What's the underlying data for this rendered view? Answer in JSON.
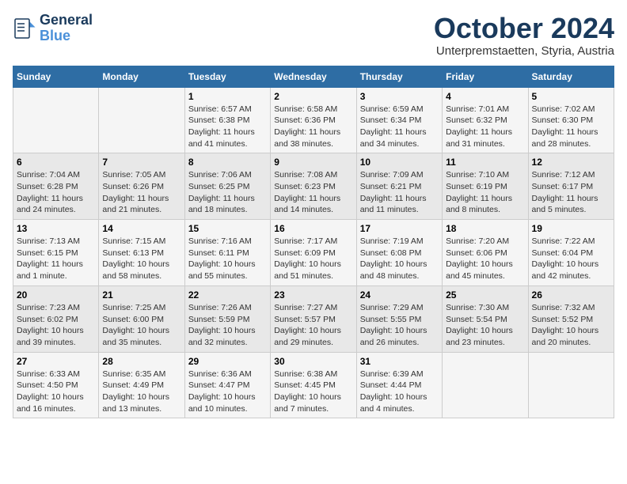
{
  "header": {
    "logo_line1": "General",
    "logo_line2": "Blue",
    "title": "October 2024",
    "subtitle": "Unterpremstaetten, Styria, Austria"
  },
  "columns": [
    "Sunday",
    "Monday",
    "Tuesday",
    "Wednesday",
    "Thursday",
    "Friday",
    "Saturday"
  ],
  "weeks": [
    [
      {
        "num": "",
        "info": ""
      },
      {
        "num": "",
        "info": ""
      },
      {
        "num": "1",
        "info": "Sunrise: 6:57 AM\nSunset: 6:38 PM\nDaylight: 11 hours and 41 minutes."
      },
      {
        "num": "2",
        "info": "Sunrise: 6:58 AM\nSunset: 6:36 PM\nDaylight: 11 hours and 38 minutes."
      },
      {
        "num": "3",
        "info": "Sunrise: 6:59 AM\nSunset: 6:34 PM\nDaylight: 11 hours and 34 minutes."
      },
      {
        "num": "4",
        "info": "Sunrise: 7:01 AM\nSunset: 6:32 PM\nDaylight: 11 hours and 31 minutes."
      },
      {
        "num": "5",
        "info": "Sunrise: 7:02 AM\nSunset: 6:30 PM\nDaylight: 11 hours and 28 minutes."
      }
    ],
    [
      {
        "num": "6",
        "info": "Sunrise: 7:04 AM\nSunset: 6:28 PM\nDaylight: 11 hours and 24 minutes."
      },
      {
        "num": "7",
        "info": "Sunrise: 7:05 AM\nSunset: 6:26 PM\nDaylight: 11 hours and 21 minutes."
      },
      {
        "num": "8",
        "info": "Sunrise: 7:06 AM\nSunset: 6:25 PM\nDaylight: 11 hours and 18 minutes."
      },
      {
        "num": "9",
        "info": "Sunrise: 7:08 AM\nSunset: 6:23 PM\nDaylight: 11 hours and 14 minutes."
      },
      {
        "num": "10",
        "info": "Sunrise: 7:09 AM\nSunset: 6:21 PM\nDaylight: 11 hours and 11 minutes."
      },
      {
        "num": "11",
        "info": "Sunrise: 7:10 AM\nSunset: 6:19 PM\nDaylight: 11 hours and 8 minutes."
      },
      {
        "num": "12",
        "info": "Sunrise: 7:12 AM\nSunset: 6:17 PM\nDaylight: 11 hours and 5 minutes."
      }
    ],
    [
      {
        "num": "13",
        "info": "Sunrise: 7:13 AM\nSunset: 6:15 PM\nDaylight: 11 hours and 1 minute."
      },
      {
        "num": "14",
        "info": "Sunrise: 7:15 AM\nSunset: 6:13 PM\nDaylight: 10 hours and 58 minutes."
      },
      {
        "num": "15",
        "info": "Sunrise: 7:16 AM\nSunset: 6:11 PM\nDaylight: 10 hours and 55 minutes."
      },
      {
        "num": "16",
        "info": "Sunrise: 7:17 AM\nSunset: 6:09 PM\nDaylight: 10 hours and 51 minutes."
      },
      {
        "num": "17",
        "info": "Sunrise: 7:19 AM\nSunset: 6:08 PM\nDaylight: 10 hours and 48 minutes."
      },
      {
        "num": "18",
        "info": "Sunrise: 7:20 AM\nSunset: 6:06 PM\nDaylight: 10 hours and 45 minutes."
      },
      {
        "num": "19",
        "info": "Sunrise: 7:22 AM\nSunset: 6:04 PM\nDaylight: 10 hours and 42 minutes."
      }
    ],
    [
      {
        "num": "20",
        "info": "Sunrise: 7:23 AM\nSunset: 6:02 PM\nDaylight: 10 hours and 39 minutes."
      },
      {
        "num": "21",
        "info": "Sunrise: 7:25 AM\nSunset: 6:00 PM\nDaylight: 10 hours and 35 minutes."
      },
      {
        "num": "22",
        "info": "Sunrise: 7:26 AM\nSunset: 5:59 PM\nDaylight: 10 hours and 32 minutes."
      },
      {
        "num": "23",
        "info": "Sunrise: 7:27 AM\nSunset: 5:57 PM\nDaylight: 10 hours and 29 minutes."
      },
      {
        "num": "24",
        "info": "Sunrise: 7:29 AM\nSunset: 5:55 PM\nDaylight: 10 hours and 26 minutes."
      },
      {
        "num": "25",
        "info": "Sunrise: 7:30 AM\nSunset: 5:54 PM\nDaylight: 10 hours and 23 minutes."
      },
      {
        "num": "26",
        "info": "Sunrise: 7:32 AM\nSunset: 5:52 PM\nDaylight: 10 hours and 20 minutes."
      }
    ],
    [
      {
        "num": "27",
        "info": "Sunrise: 6:33 AM\nSunset: 4:50 PM\nDaylight: 10 hours and 16 minutes."
      },
      {
        "num": "28",
        "info": "Sunrise: 6:35 AM\nSunset: 4:49 PM\nDaylight: 10 hours and 13 minutes."
      },
      {
        "num": "29",
        "info": "Sunrise: 6:36 AM\nSunset: 4:47 PM\nDaylight: 10 hours and 10 minutes."
      },
      {
        "num": "30",
        "info": "Sunrise: 6:38 AM\nSunset: 4:45 PM\nDaylight: 10 hours and 7 minutes."
      },
      {
        "num": "31",
        "info": "Sunrise: 6:39 AM\nSunset: 4:44 PM\nDaylight: 10 hours and 4 minutes."
      },
      {
        "num": "",
        "info": ""
      },
      {
        "num": "",
        "info": ""
      }
    ]
  ]
}
